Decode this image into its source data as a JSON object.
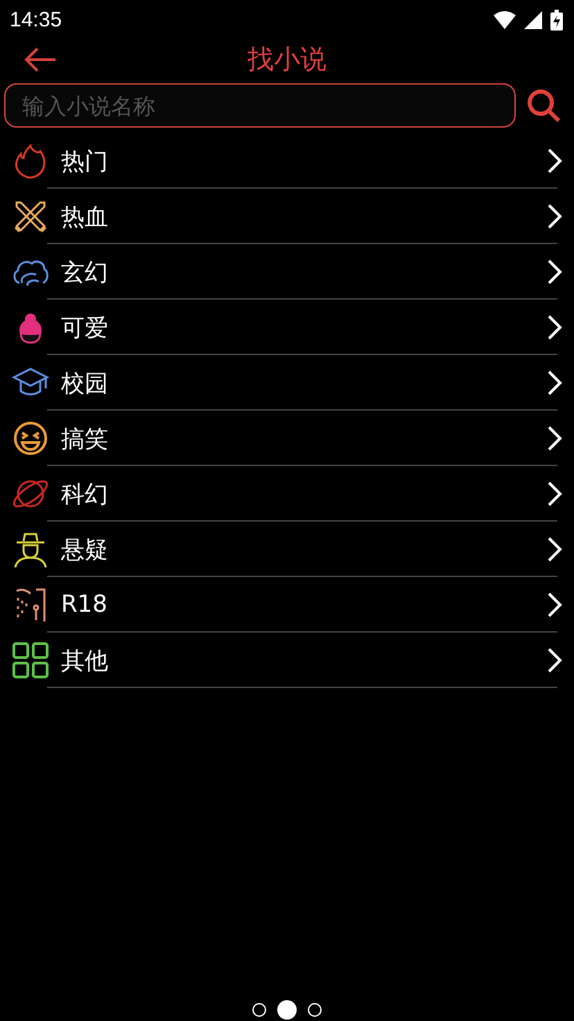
{
  "status_bar": {
    "time": "14:35"
  },
  "header": {
    "title": "找小说"
  },
  "search": {
    "placeholder": "输入小说名称"
  },
  "categories": [
    {
      "label": "热门",
      "kind": "flame"
    },
    {
      "label": "热血",
      "kind": "swords"
    },
    {
      "label": "玄幻",
      "kind": "cloud"
    },
    {
      "label": "可爱",
      "kind": "girl"
    },
    {
      "label": "校园",
      "kind": "cap"
    },
    {
      "label": "搞笑",
      "kind": "laugh"
    },
    {
      "label": "科幻",
      "kind": "planet"
    },
    {
      "label": "悬疑",
      "kind": "detective"
    },
    {
      "label": "R18",
      "kind": "shower"
    },
    {
      "label": "其他",
      "kind": "grid"
    }
  ],
  "pages": [
    {
      "selected": false
    },
    {
      "selected": true
    },
    {
      "selected": false
    }
  ]
}
